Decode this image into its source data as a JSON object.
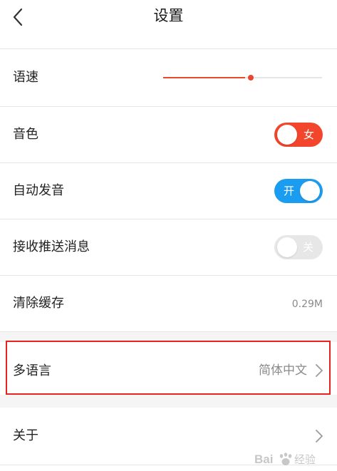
{
  "header": {
    "title": "设置"
  },
  "settings": {
    "speed": {
      "label": "语速",
      "value_fraction": 0.55
    },
    "voice": {
      "label": "音色",
      "toggle_text": "女"
    },
    "auto_play": {
      "label": "自动发音",
      "toggle_text": "开"
    },
    "push": {
      "label": "接收推送消息",
      "toggle_text": "关"
    },
    "cache": {
      "label": "清除缓存",
      "value": "0.29M"
    },
    "language": {
      "label": "多语言",
      "value": "简体中文"
    },
    "about": {
      "label": "关于"
    }
  },
  "watermark": {
    "text": "Bai 经验"
  },
  "colors": {
    "accent_red": "#f2452b",
    "accent_blue": "#1a9cf0",
    "toggle_off": "#e7e7e7",
    "highlight_border": "#e8231f"
  },
  "icons": {
    "back": "chevron-left-icon",
    "chevron": "chevron-right-icon"
  }
}
